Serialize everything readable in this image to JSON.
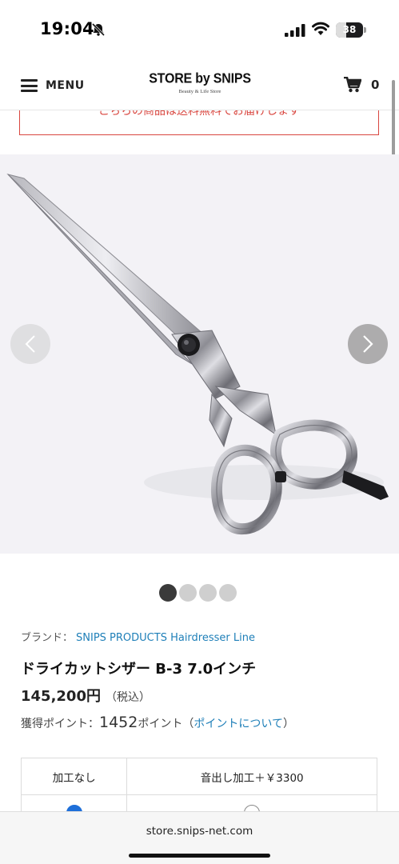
{
  "status_bar": {
    "time": "19:04",
    "battery": "38"
  },
  "header": {
    "menu_label": "MENU",
    "logo_main": "STORE by SNIPS",
    "logo_sub": "Beauty & Life Store",
    "cart_count": "0"
  },
  "notice": {
    "text": "こちらの商品は送料無料でお届けします"
  },
  "gallery": {
    "total_slides": 4,
    "active_slide": 1
  },
  "product": {
    "brand_label": "ブランド：",
    "brand_name": "SNIPS PRODUCTS Hairdresser Line",
    "title": "ドライカットシザー B-3 7.0インチ",
    "price": "145,200円",
    "tax_note": "（税込）",
    "points_label": "獲得ポイント：",
    "points_value": "1452",
    "points_unit": "ポイント",
    "points_link_open": "（",
    "points_link": "ポイントについて",
    "points_link_close": "）"
  },
  "options": {
    "columns": [
      "加工なし",
      "音出し加工＋￥3300"
    ],
    "selected_index": 0
  },
  "browser": {
    "url": "store.snips-net.com"
  },
  "colors": {
    "link": "#1e7fb8",
    "notice": "#d9463f",
    "radio": "#1e6fd9"
  }
}
